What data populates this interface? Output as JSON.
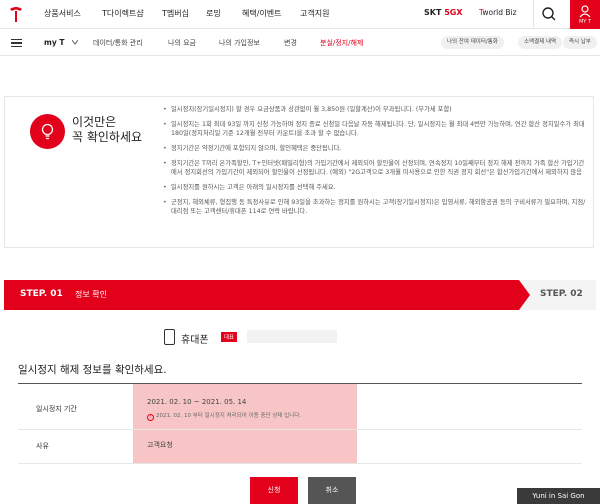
{
  "topnav": {
    "logo": "t-logo-icon",
    "menu": [
      "상품서비스",
      "T다이렉트샵",
      "T멤버십",
      "로밍",
      "혜택/이벤트",
      "고객지원"
    ],
    "brand_5gx_prefix": "SKT",
    "brand_5gx": "5GX",
    "brand_worldbiz_prefix": "T",
    "brand_worldbiz": "world Biz",
    "mypage_label": "MY T"
  },
  "subnav": {
    "myt": "my T",
    "items": [
      "데이터/통화 관리",
      "나의 요금",
      "나의 가입정보",
      "변경",
      "분실/정지/해제"
    ],
    "pills": [
      "나의 잔여 데이터/통화",
      "소액결제 내역",
      "즉시 납부"
    ]
  },
  "notice": {
    "title_line1": "이것만은",
    "title_line2": "꼭 확인하세요",
    "items": [
      "일시정지(장기일시정지) 할 경우 요금상품과 상관없이 월 3,850원 (일할계산)이 부과됩니다. (부가세 포함)",
      "일시정지는 1회 최대 93일 까지 신청 가능하며 정지 종료 신청일 다음날 자동 해제됩니다. 단, 일시정지는 월 최대 4번만 가능하며, 연간 합산 정지일수가 최대 180일(정지처리일 기준 12개월 전부터 카운트)을 초과 할 수 없습니다.",
      "정지기간은 약정기간에 포함되지 않으며, 할인혜택은 중단됩니다.",
      "정지기간은 T끼리 온가족할인, T+인터넷(패밀리형)의 가입기간에서 제외되어 할인율이 산정되며, 연속정지 10일째부터 정지 해제 전까지 가족 합산 가입기간에서 정지회선의 가입기간이 제외되어 할인율이 산정됩니다. (예외) \"2G고객으로 3개월 미사용으로 인한 직권 정지 회선\"은 합산가입기간에서 제외하지 않음",
      "일시정지를 원하시는 고객은 아래의 일시정지를 선택해 주세요.",
      "군정지, 해외체류, 형집행 등 특정사유로 인해 93일을 초과하는 정지를 원하시는 고객(장기일시정지)은 입영서류, 해외항공권 등의 구비서류가 필요하며, 지점/대리점 또는 고객센터/휴대폰 114로 연락 바랍니다."
    ]
  },
  "steps": {
    "step1_num": "STEP. 01",
    "step1_label": "정보 확인",
    "step2_num": "STEP. 02"
  },
  "device": {
    "name": "휴대폰",
    "badge": "대표"
  },
  "section_title": "일시정지 해제 정보를 확인하세요.",
  "info": {
    "period_label": "일시정지 기간",
    "period_value": "2021. 02. 10 ~ 2021. 05. 14",
    "period_note": "2021. 02. 10 부터 일시정지 처리되어 이용 중단 상태 입니다.",
    "reason_label": "사유",
    "reason_value": "고객요청"
  },
  "buttons": {
    "confirm": "신청",
    "cancel": "취소"
  },
  "watermark": "Yuni in Sai Gon",
  "colors": {
    "accent": "#e2001a",
    "highlight": "#f09696"
  }
}
